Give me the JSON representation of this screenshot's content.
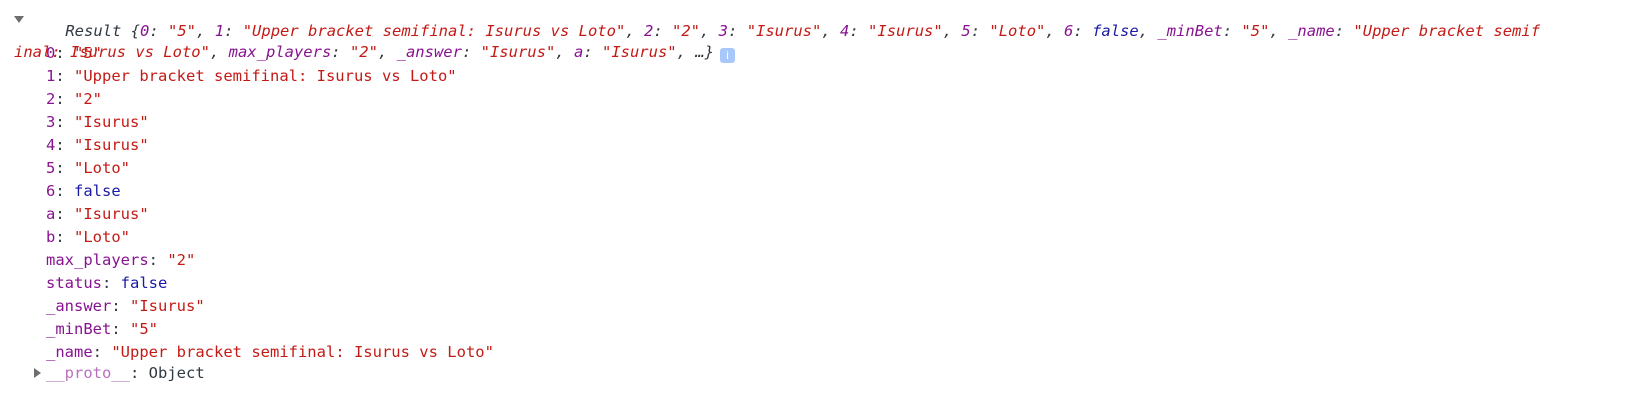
{
  "summary": {
    "label": "Result",
    "open": " {",
    "entries": [
      {
        "key": "0",
        "value": "\"5\"",
        "type": "str"
      },
      {
        "key": "1",
        "value": "\"Upper bracket semifinal: Isurus vs Loto\"",
        "type": "str"
      },
      {
        "key": "2",
        "value": "\"2\"",
        "type": "str"
      },
      {
        "key": "3",
        "value": "\"Isurus\"",
        "type": "str"
      },
      {
        "key": "4",
        "value": "\"Isurus\"",
        "type": "str"
      },
      {
        "key": "5",
        "value": "\"Loto\"",
        "type": "str"
      },
      {
        "key": "6",
        "value": "false",
        "type": "bool"
      },
      {
        "key": "_minBet",
        "value": "\"5\"",
        "type": "str"
      },
      {
        "key": "_name",
        "value": "\"Upper bracket semifinal: Isurus vs Loto\"",
        "type": "str"
      },
      {
        "key": "max_players",
        "value": "\"2\"",
        "type": "str"
      },
      {
        "key": "_answer",
        "value": "\"Isurus\"",
        "type": "str"
      },
      {
        "key": "a",
        "value": "\"Isurus\"",
        "type": "str"
      }
    ],
    "ellipsis": "…}",
    "info_glyph": "i"
  },
  "properties": [
    {
      "key": "0",
      "value": "\"5\"",
      "type": "str",
      "indexed": true
    },
    {
      "key": "1",
      "value": "\"Upper bracket semifinal: Isurus vs Loto\"",
      "type": "str",
      "indexed": true
    },
    {
      "key": "2",
      "value": "\"2\"",
      "type": "str",
      "indexed": true
    },
    {
      "key": "3",
      "value": "\"Isurus\"",
      "type": "str",
      "indexed": true
    },
    {
      "key": "4",
      "value": "\"Isurus\"",
      "type": "str",
      "indexed": true
    },
    {
      "key": "5",
      "value": "\"Loto\"",
      "type": "str",
      "indexed": true
    },
    {
      "key": "6",
      "value": "false",
      "type": "bool",
      "indexed": true
    },
    {
      "key": "a",
      "value": "\"Isurus\"",
      "type": "str",
      "indexed": true
    },
    {
      "key": "b",
      "value": "\"Loto\"",
      "type": "str",
      "indexed": true
    },
    {
      "key": "max_players",
      "value": "\"2\"",
      "type": "str",
      "indexed": false
    },
    {
      "key": "status",
      "value": "false",
      "type": "bool",
      "indexed": false
    },
    {
      "key": "_answer",
      "value": "\"Isurus\"",
      "type": "str",
      "indexed": false
    },
    {
      "key": "_minBet",
      "value": "\"5\"",
      "type": "str",
      "indexed": false
    },
    {
      "key": "_name",
      "value": "\"Upper bracket semifinal: Isurus vs Loto\"",
      "type": "str",
      "indexed": false
    }
  ],
  "proto": {
    "key": "__proto__",
    "value": "Object"
  },
  "colors": {
    "property": "#881391",
    "string": "#c41a16",
    "boolean": "#1a1aa6",
    "text": "#303942",
    "info_badge": "#a8c7fa"
  }
}
